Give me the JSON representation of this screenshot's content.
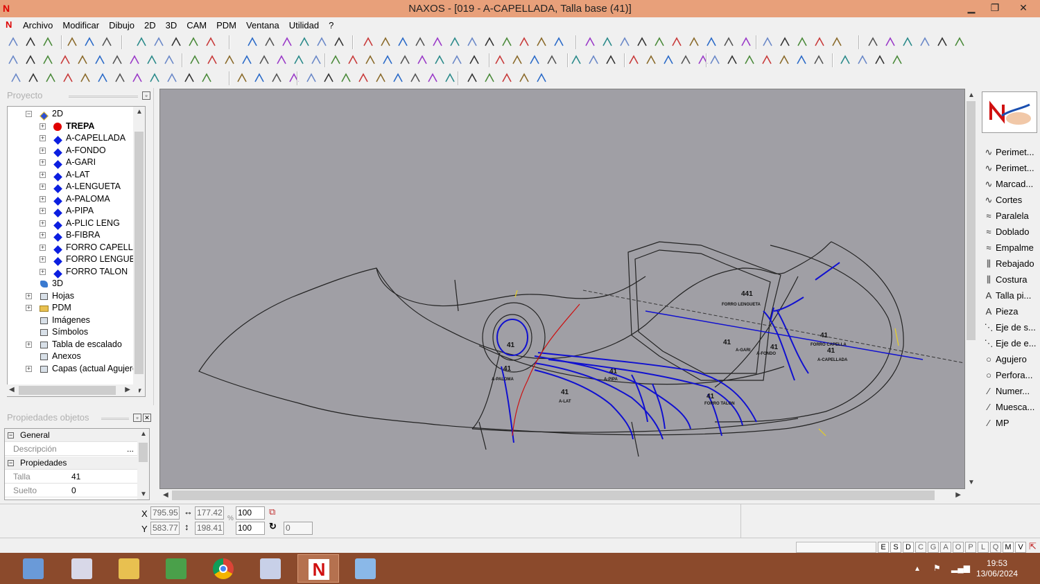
{
  "window": {
    "title": "NAXOS - [019 - A-CAPELLADA, Talla base (41)]",
    "app_icon": "naxos-n-icon",
    "minimize": "▁",
    "maximize": "❐",
    "close": "✕"
  },
  "menu": {
    "items": [
      "Archivo",
      "Modificar",
      "Dibujo",
      "2D",
      "3D",
      "CAM",
      "PDM",
      "Ventana",
      "Utilidad",
      "?"
    ],
    "mdi_min": "–",
    "mdi_restore": "❐",
    "mdi_close": "✕"
  },
  "project_panel": {
    "title": "Proyecto",
    "pin": "▫",
    "tree": [
      {
        "label": "2D",
        "level": 0,
        "icon": "2d-diamond-icon",
        "expander": "−"
      },
      {
        "label": "TREPA",
        "level": 1,
        "icon": "red-dot-icon",
        "expander": "+",
        "bold": true
      },
      {
        "label": "A-CAPELLADA",
        "level": 1,
        "icon": "blue-diamond-icon",
        "expander": "+"
      },
      {
        "label": "A-FONDO",
        "level": 1,
        "icon": "blue-diamond-icon",
        "expander": "+"
      },
      {
        "label": "A-GARI",
        "level": 1,
        "icon": "blue-diamond-icon",
        "expander": "+"
      },
      {
        "label": "A-LAT",
        "level": 1,
        "icon": "blue-diamond-icon",
        "expander": "+"
      },
      {
        "label": "A-LENGUETA",
        "level": 1,
        "icon": "blue-diamond-icon",
        "expander": "+"
      },
      {
        "label": "A-PALOMA",
        "level": 1,
        "icon": "blue-diamond-icon",
        "expander": "+"
      },
      {
        "label": "A-PIPA",
        "level": 1,
        "icon": "blue-diamond-icon",
        "expander": "+"
      },
      {
        "label": "A-PLIC LENG",
        "level": 1,
        "icon": "blue-diamond-icon",
        "expander": "+"
      },
      {
        "label": "B-FIBRA",
        "level": 1,
        "icon": "blue-diamond-icon",
        "expander": "+"
      },
      {
        "label": "FORRO CAPELLA",
        "level": 1,
        "icon": "blue-diamond-icon",
        "expander": "+"
      },
      {
        "label": "FORRO LENGUE",
        "level": 1,
        "icon": "blue-diamond-icon",
        "expander": "+"
      },
      {
        "label": "FORRO TALON",
        "level": 1,
        "icon": "blue-diamond-icon",
        "expander": "+"
      },
      {
        "label": "3D",
        "level": 0,
        "icon": "3d-icon",
        "expander": ""
      },
      {
        "label": "Hojas",
        "level": 0,
        "icon": "sheets-icon",
        "expander": "+"
      },
      {
        "label": "PDM",
        "level": 0,
        "icon": "folder-icon",
        "expander": "+"
      },
      {
        "label": "Imágenes",
        "level": 0,
        "icon": "images-icon",
        "expander": ""
      },
      {
        "label": "Símbolos",
        "level": 0,
        "icon": "symbols-icon",
        "expander": ""
      },
      {
        "label": "Tabla de escalado",
        "level": 0,
        "icon": "scale-table-icon",
        "expander": "+"
      },
      {
        "label": "Anexos",
        "level": 0,
        "icon": "paperclip-icon",
        "expander": ""
      },
      {
        "label": "Capas (actual Agujeros)",
        "level": 0,
        "icon": "layers-icon",
        "expander": "+"
      }
    ]
  },
  "props_panel": {
    "title": "Propiedades objetos",
    "groups": [
      {
        "name": "General",
        "rows": [
          {
            "key": "Descripción",
            "value": "",
            "button": "..."
          }
        ]
      },
      {
        "name": "Propiedades",
        "rows": [
          {
            "key": "Talla",
            "value": "41"
          },
          {
            "key": "Suelto",
            "value": "0"
          }
        ]
      }
    ]
  },
  "palette": {
    "logo": "naxos-logo-hand",
    "items": [
      {
        "label": "Perimet...",
        "icon": "curve-icon"
      },
      {
        "label": "Perimet...",
        "icon": "curve-icon"
      },
      {
        "label": "Marcad...",
        "icon": "curve-icon"
      },
      {
        "label": "Cortes",
        "icon": "curve-icon"
      },
      {
        "label": "Paralela",
        "icon": "parallel-curve-icon"
      },
      {
        "label": "Doblado",
        "icon": "parallel-curve-icon"
      },
      {
        "label": "Empalme",
        "icon": "parallel-curve-icon"
      },
      {
        "label": "Rebajado",
        "icon": "hatch-icon"
      },
      {
        "label": "Costura",
        "icon": "hatch-icon"
      },
      {
        "label": "Talla pi...",
        "icon": "text-a-icon"
      },
      {
        "label": "Pieza",
        "icon": "text-a-icon"
      },
      {
        "label": "Eje de s...",
        "icon": "dash-axis-icon"
      },
      {
        "label": "Eje de e...",
        "icon": "dash-axis-icon"
      },
      {
        "label": "Agujero",
        "icon": "circle-icon"
      },
      {
        "label": "Perfora...",
        "icon": "circle-icon"
      },
      {
        "label": "Numer...",
        "icon": "pen-icon"
      },
      {
        "label": "Muesca...",
        "icon": "pen-icon"
      },
      {
        "label": "MP",
        "icon": "pen-icon"
      }
    ]
  },
  "coords": {
    "x_label": "X",
    "y_label": "Y",
    "x": "795.95",
    "y": "583.77",
    "width": "177.42",
    "height": "198.41",
    "scale_x": "100",
    "scale_y": "100",
    "percent": "%",
    "rotation": "0"
  },
  "status_flags": [
    "E",
    "S",
    "D",
    "C",
    "G",
    "A",
    "O",
    "P",
    "L",
    "Q",
    "M",
    "V"
  ],
  "status_active": [
    "E",
    "S",
    "D",
    "M",
    "V"
  ],
  "canvas_labels": [
    {
      "text": "441"
    },
    {
      "text": "FORRO LENGUETA"
    },
    {
      "text": "41"
    },
    {
      "text": "FORRO CAPELLA"
    },
    {
      "text": "41"
    },
    {
      "text": "A-CAPELLADA"
    },
    {
      "text": "41"
    },
    {
      "text": "A-GARI"
    },
    {
      "text": "41"
    },
    {
      "text": "41"
    },
    {
      "text": "A-PALOMA"
    },
    {
      "text": "41"
    },
    {
      "text": "A-LAT"
    },
    {
      "text": "41"
    },
    {
      "text": "A-PIPA"
    },
    {
      "text": "41"
    },
    {
      "text": "FORRO TALON"
    },
    {
      "text": "41"
    },
    {
      "text": "A-FONDO"
    }
  ],
  "taskbar": {
    "apps": [
      "calculator-icon",
      "explorer-icon",
      "folder-icon",
      "green-app-icon",
      "chrome-icon",
      "pencil-icon",
      "naxos-icon",
      "blue-app-icon"
    ],
    "active": "naxos-icon",
    "time": "19:53",
    "date": "13/06/2024",
    "tray": [
      "chevron-up-icon",
      "flag-icon",
      "signal-icon"
    ]
  }
}
